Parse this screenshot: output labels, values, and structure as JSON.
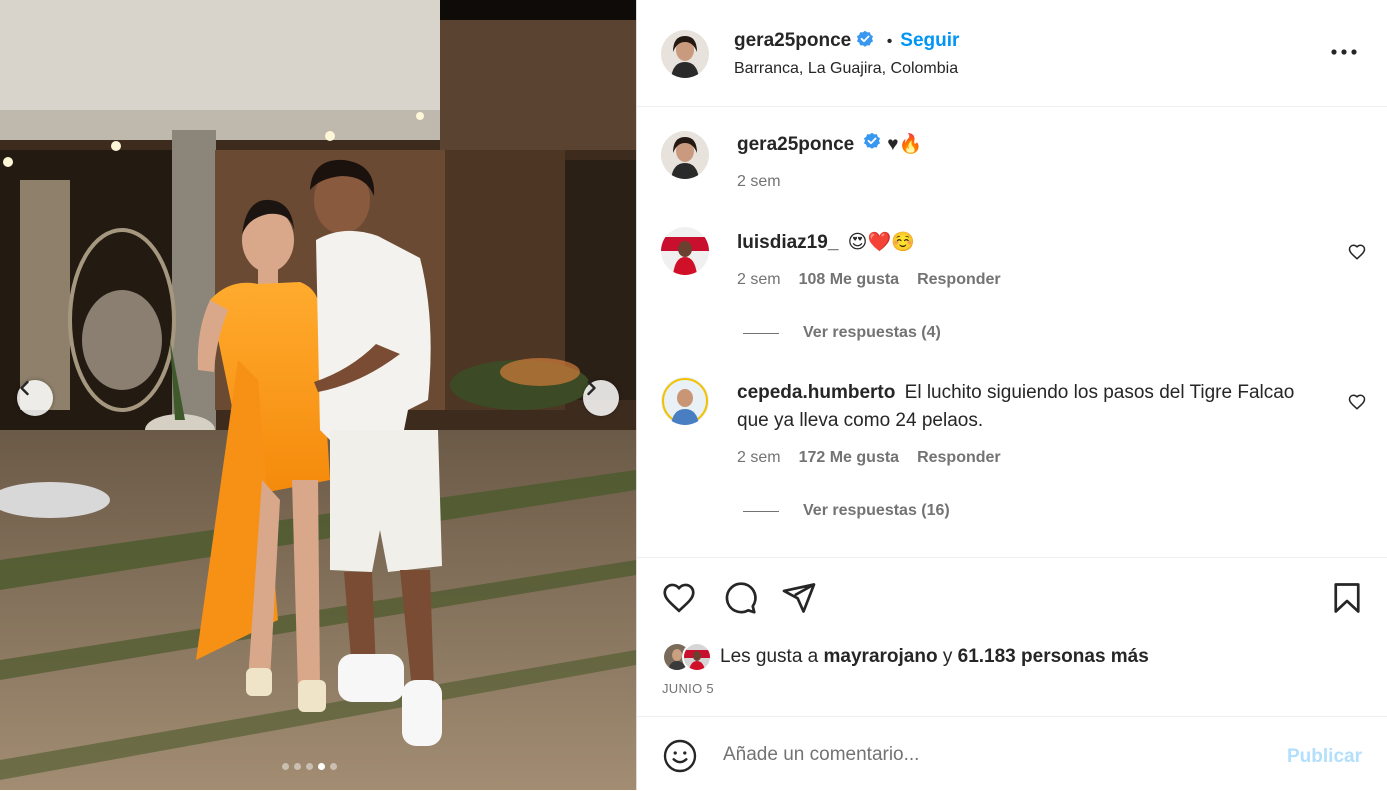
{
  "header": {
    "username": "gera25ponce",
    "separator": "•",
    "follow_label": "Seguir",
    "location": "Barranca, La Guajira, Colombia"
  },
  "caption": {
    "username": "gera25ponce",
    "text": "♥🔥",
    "time": "2 sem"
  },
  "comments": [
    {
      "username": "luisdiaz19_",
      "text": "😍❤️☺️",
      "time": "2 sem",
      "likes": "108 Me gusta",
      "reply_label": "Responder",
      "view_replies": "Ver respuestas (4)"
    },
    {
      "username": "cepeda.humberto",
      "text": "El luchito siguiendo los pasos del Tigre Falcao que ya lleva como 24 pelaos.",
      "time": "2 sem",
      "likes": "172 Me gusta",
      "reply_label": "Responder",
      "view_replies": "Ver respuestas (16)"
    }
  ],
  "likes": {
    "prefix": "Les gusta a",
    "user": "mayrarojano",
    "conj": "y",
    "others": "61.183 personas más"
  },
  "date": "JUNIO 5",
  "add_comment": {
    "placeholder": "Añade un comentario...",
    "publish_label": "Publicar"
  },
  "carousel": {
    "total": 5,
    "active": 4
  },
  "colors": {
    "accent": "#0095f6",
    "verified": "#3897f0",
    "publish_disabled": "#b2dffc"
  }
}
